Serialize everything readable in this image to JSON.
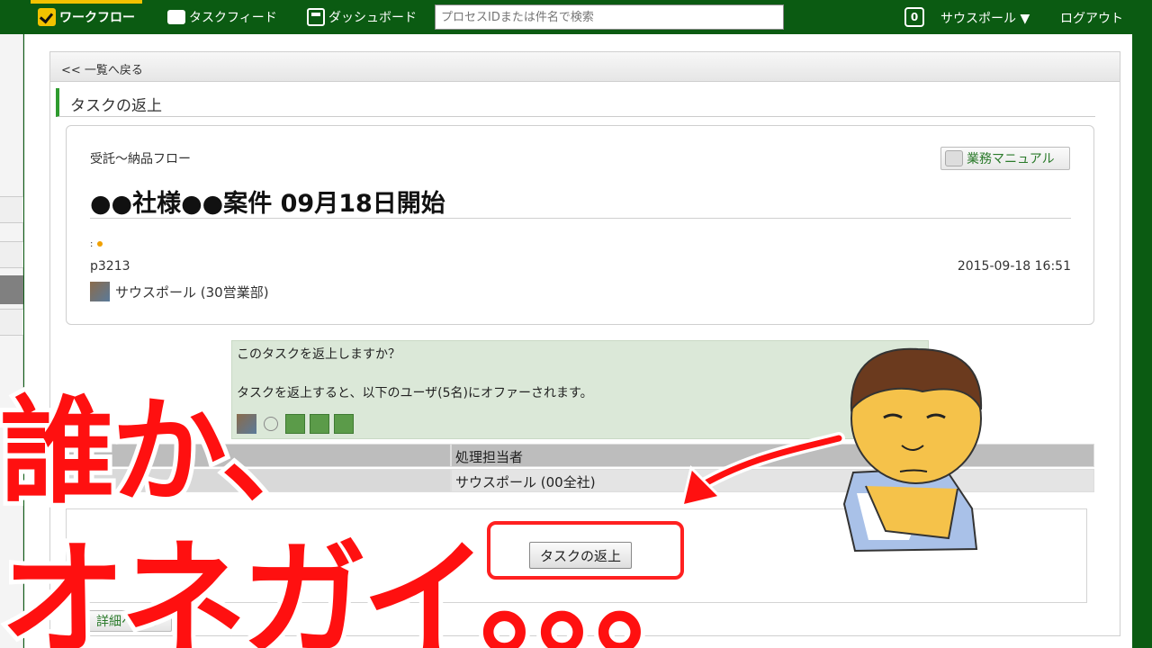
{
  "nav": {
    "workflow": "ワークフロー",
    "taskfeed": "タスクフィード",
    "dashboard": "ダッシュボード",
    "search_placeholder": "プロセスIDまたは件名で検索",
    "notification_count": "0",
    "user": "サウスポール ▼",
    "logout": "ログアウト"
  },
  "back_link": "<< 一覧へ戻る",
  "section_title": "タスクの返上",
  "card": {
    "flow_name": "受託～納品フロー",
    "manual_button": "業務マニュアル",
    "title": "●●社様●●案件 09月18日開始",
    "process_id": "p3213",
    "timestamp": "2015-09-18 16:51",
    "owner": "サウスポール (30営業部)"
  },
  "confirm": {
    "question": "このタスクを返上しますか？",
    "message": "タスクを返上すると、以下のユーザ(5名)にオファーされます。"
  },
  "table": {
    "header_value": "処理担当者",
    "row_value": "サウスポール (00全社)"
  },
  "return_button": "タスクの返上",
  "detail_button": "詳細へ戻る",
  "overlay": {
    "line1": "誰か、",
    "line2": "オネガイ。。。"
  },
  "colors": {
    "topbar": "#0b5b12",
    "accent_yellow": "#f2c200",
    "overlay_red": "#ff1010",
    "confirm_bg": "#dbe8d8"
  },
  "icons": [
    "check-icon",
    "chat-bubble-icon",
    "dashboard-icon",
    "manual-icon",
    "avatar-photo",
    "avatar-face",
    "user-green-icon",
    "back-icon"
  ]
}
